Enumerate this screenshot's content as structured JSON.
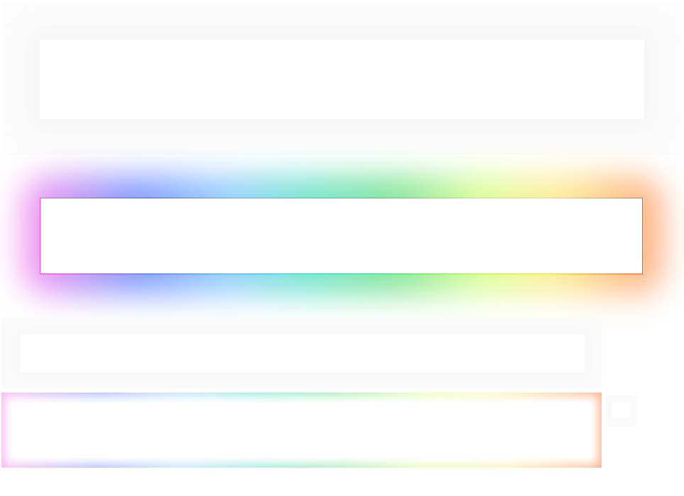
{
  "panels": {
    "top_glow": {
      "style": "soft-grey-glow"
    },
    "rainbow_glow": {
      "style": "rainbow-glow",
      "colors": [
        "#ff44d6",
        "#3b5bff",
        "#53a8ff",
        "#1ecfb3",
        "#36d36a",
        "#b6f04a",
        "#f3df3d",
        "#ff5a2a"
      ]
    },
    "lower_glow": {
      "style": "soft-grey-glow"
    },
    "bottom_rainbow_frame": {
      "style": "rainbow-inset",
      "colors": [
        "#ffb6f2",
        "#a9b6ff",
        "#bfe1ff",
        "#8ce9d6",
        "#a2ebb3",
        "#e6ffb1",
        "#fff1b6",
        "#ffb08c"
      ]
    }
  }
}
